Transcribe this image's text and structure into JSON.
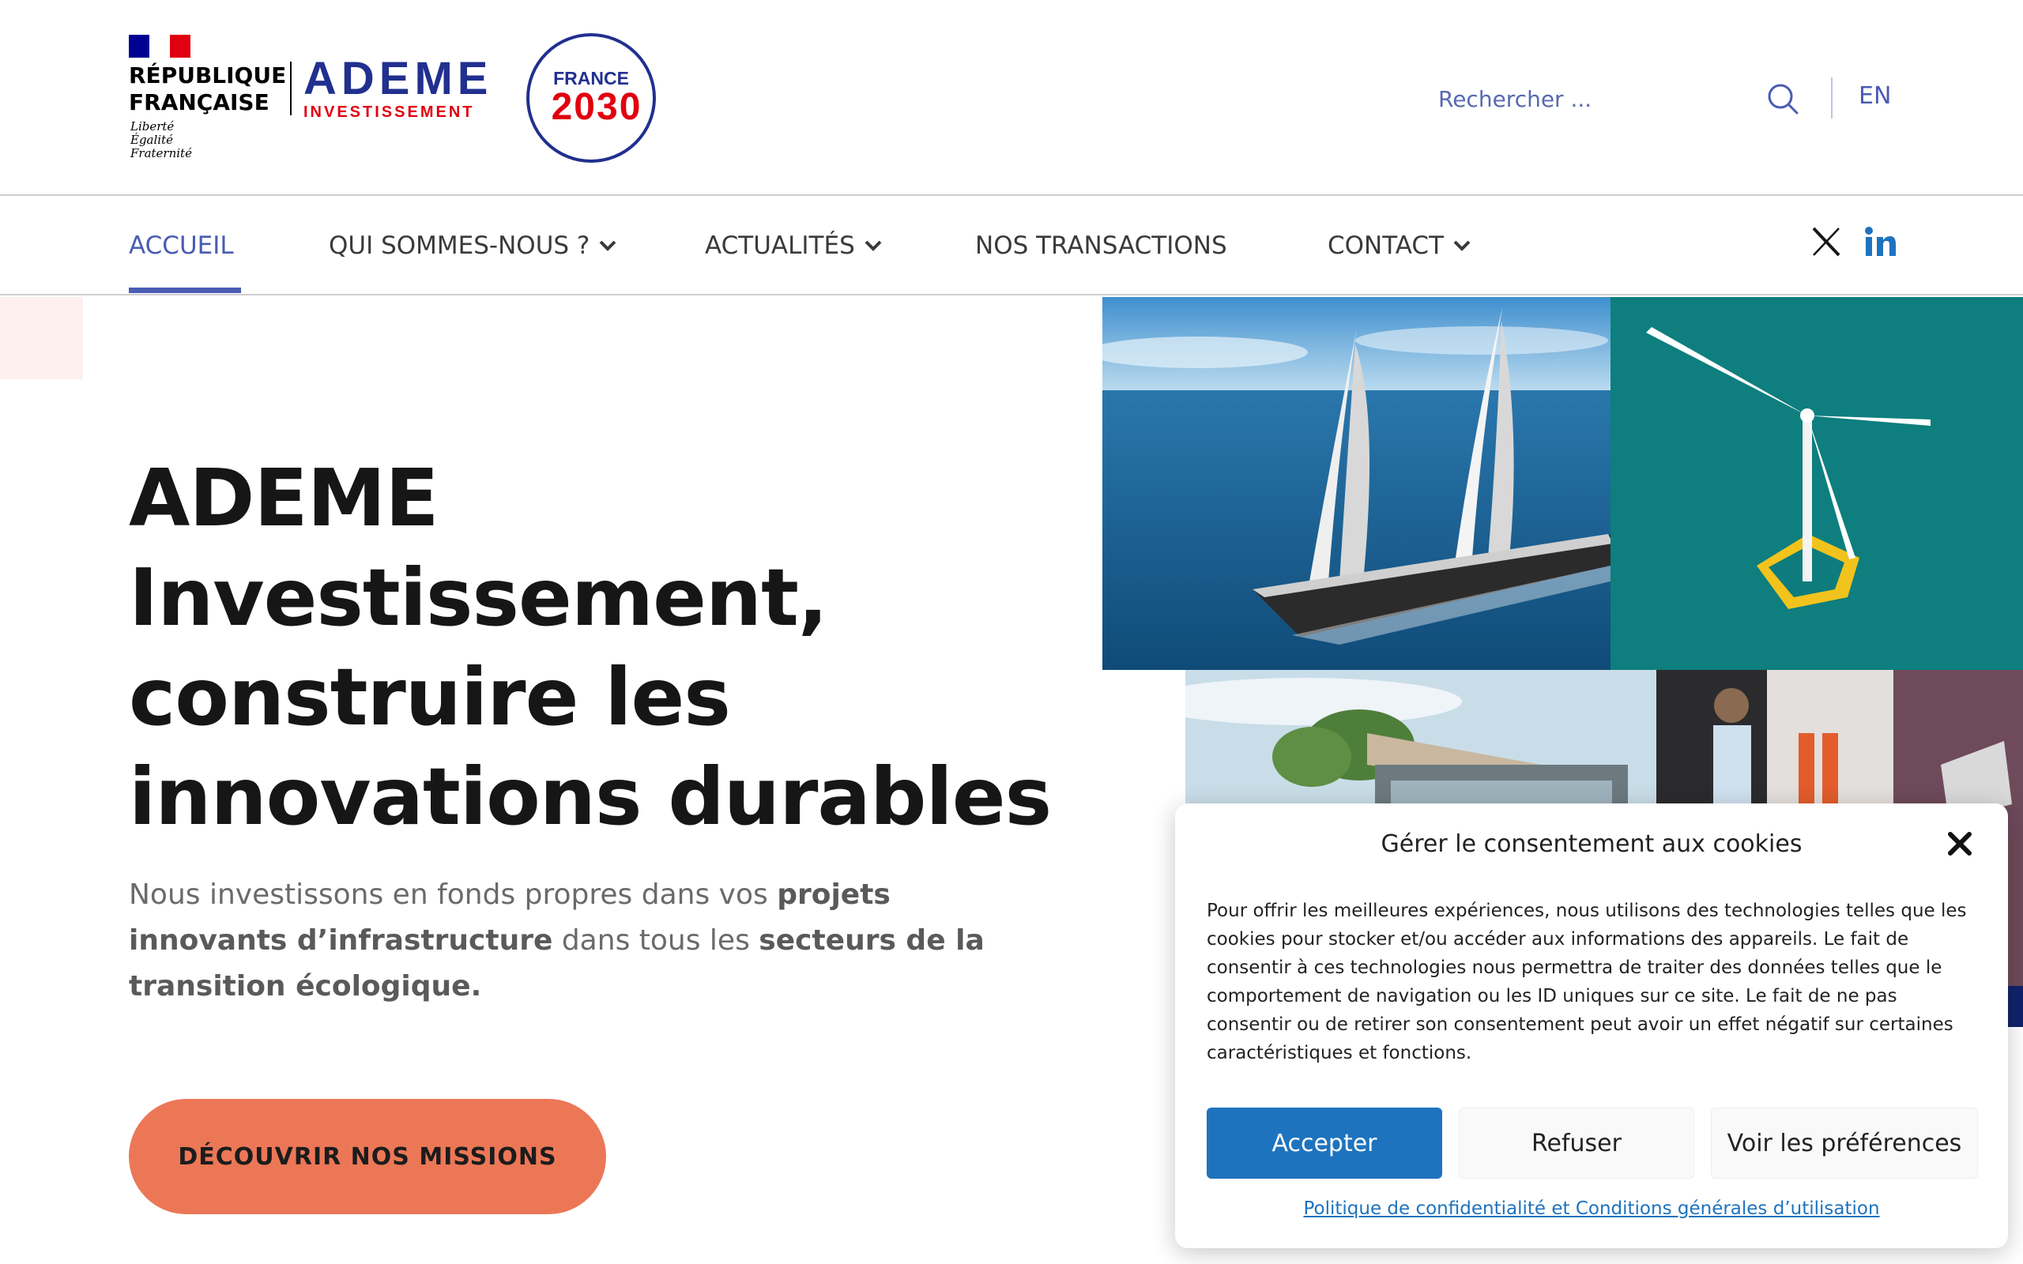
{
  "header": {
    "republique": "RÉPUBLIQUE\nFRANÇAISE",
    "motto": "Liberté\nÉgalité\nFraternité",
    "brand_name": "ADEME",
    "brand_sub": "INVESTISSEMENT",
    "france2030_label": "FRANCE",
    "france2030_year": "2030",
    "search_placeholder": "Rechercher ...",
    "lang": "EN"
  },
  "nav": {
    "items": [
      {
        "label": "ACCUEIL",
        "active": true
      },
      {
        "label": "QUI SOMMES-NOUS ?",
        "dropdown": true
      },
      {
        "label": "ACTUALITÉS",
        "dropdown": true
      },
      {
        "label": "NOS TRANSACTIONS"
      },
      {
        "label": "CONTACT",
        "dropdown": true
      }
    ],
    "social": [
      "x-icon",
      "linkedin-icon"
    ]
  },
  "hero": {
    "title": "ADEME Investissement, construire les innovations durables",
    "text_1": "Nous investissons en fonds propres dans vos ",
    "text_bold_1": "projets innovants d’infrastructure",
    "text_2": " dans tous les ",
    "text_bold_2": "secteurs de la transition écologique.",
    "cta": "DÉCOUVRIR NOS MISSIONS"
  },
  "cookie": {
    "title": "Gérer le consentement aux cookies",
    "body": "Pour offrir les meilleures expériences, nous utilisons des technologies telles que les cookies pour stocker et/ou accéder aux informations des appareils. Le fait de consentir à ces technologies nous permettra de traiter des données telles que le comportement de navigation ou les ID uniques sur ce site. Le fait de ne pas consentir ou de retirer son consentement peut avoir un effet négatif sur certaines caractéristiques et fonctions.",
    "accept": "Accepter",
    "refuse": "Refuser",
    "preferences": "Voir les préférences",
    "policy": "Politique de confidentialité et Conditions générales d’utilisation"
  },
  "colors": {
    "brand_blue": "#21308f",
    "nav_active": "#4a5cb3",
    "cta": "#ec7757",
    "accept_button": "#1e73be",
    "marianne_red": "#e1000f"
  }
}
